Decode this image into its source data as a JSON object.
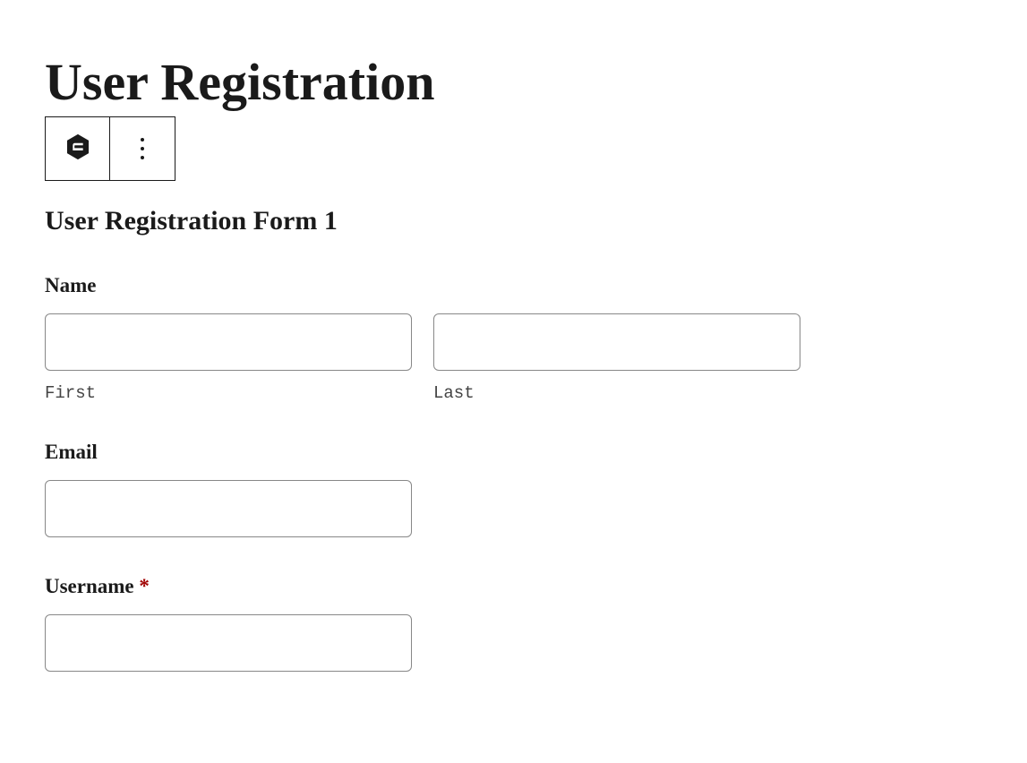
{
  "page": {
    "title": "User Registration"
  },
  "form": {
    "title": "User Registration Form 1",
    "fields": {
      "name": {
        "label": "Name",
        "first": {
          "value": "",
          "sublabel": "First"
        },
        "last": {
          "value": "",
          "sublabel": "Last"
        }
      },
      "email": {
        "label": "Email",
        "value": ""
      },
      "username": {
        "label": "Username ",
        "required_mark": "*",
        "value": ""
      }
    }
  }
}
